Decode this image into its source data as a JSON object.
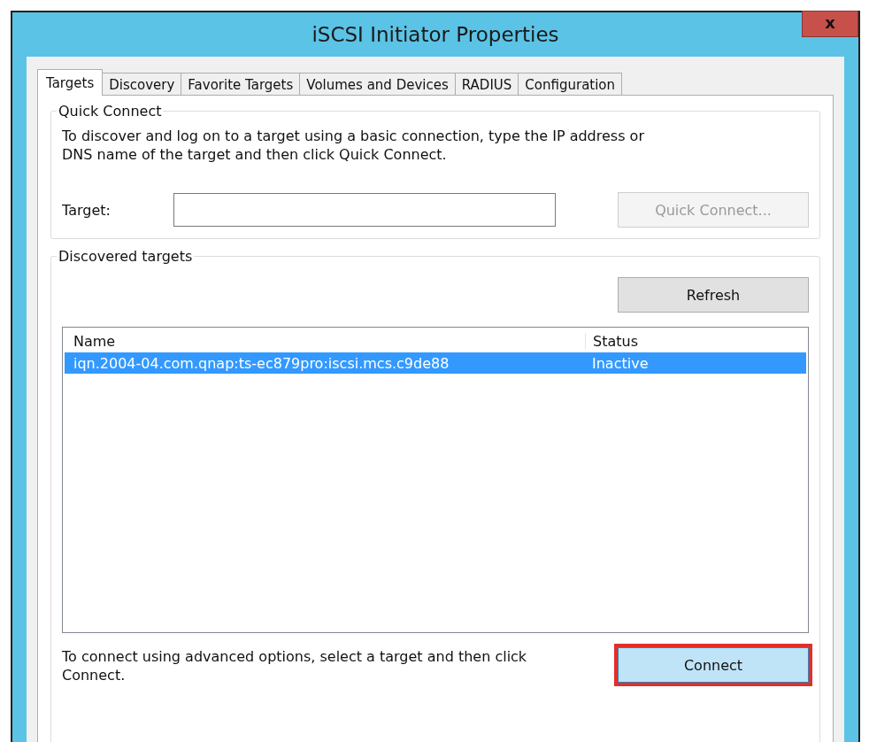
{
  "window": {
    "title": "iSCSI Initiator Properties",
    "close_label": "x"
  },
  "tabs": [
    {
      "label": "Targets",
      "selected": true
    },
    {
      "label": "Discovery",
      "selected": false
    },
    {
      "label": "Favorite Targets",
      "selected": false
    },
    {
      "label": "Volumes and Devices",
      "selected": false
    },
    {
      "label": "RADIUS",
      "selected": false
    },
    {
      "label": "Configuration",
      "selected": false
    }
  ],
  "quick_connect": {
    "title": "Quick Connect",
    "description": "To discover and log on to a target using a basic connection, type the IP address or DNS name of the target and then click Quick Connect.",
    "target_label": "Target:",
    "button": {
      "label": "Quick Connect...",
      "disabled": true
    }
  },
  "discovered_targets": {
    "title": "Discovered targets",
    "refresh_button": "Refresh",
    "columns": [
      "Name",
      "Status"
    ],
    "rows": [
      {
        "name": "iqn.2004-04.com.qnap:ts-ec879pro:iscsi.mcs.c9de88",
        "status": "Inactive",
        "selected": true
      }
    ],
    "footer_text": "To connect using advanced options, select a target and then click Connect.",
    "connect_button": {
      "label": "Connect",
      "highlighted": true
    }
  }
}
